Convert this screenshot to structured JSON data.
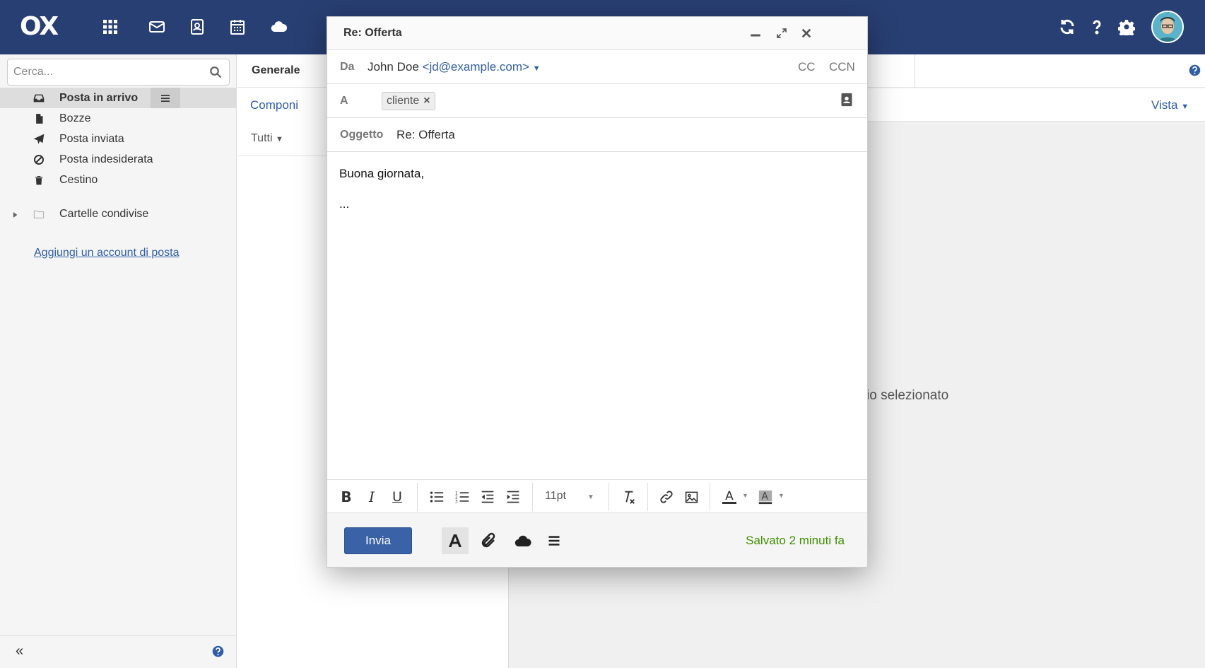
{
  "topbar": {
    "logo": "OX",
    "icons": [
      "apps-grid-icon",
      "mail-icon",
      "addressbook-icon",
      "calendar-icon",
      "cloud-icon",
      "refresh-icon",
      "help-icon",
      "settings-gear-icon",
      "avatar"
    ]
  },
  "sidebar": {
    "search_placeholder": "Cerca...",
    "folders": [
      {
        "label": "Posta in arrivo",
        "icon": "inbox-icon"
      },
      {
        "label": "Bozze",
        "icon": "document-icon"
      },
      {
        "label": "Posta inviata",
        "icon": "send-icon"
      },
      {
        "label": "Posta indesiderata",
        "icon": "blocked-icon"
      },
      {
        "label": "Cestino",
        "icon": "trash-icon"
      }
    ],
    "shared_folders": "Cartelle condivise",
    "add_account": "Aggiungi un account di posta",
    "collapse": "«"
  },
  "list": {
    "tab": "Generale",
    "compose": "Componi",
    "filter": "Tutti"
  },
  "detail": {
    "view": "Vista",
    "no_selection": "io selezionato"
  },
  "compose": {
    "title": "Re: Offerta",
    "from_label": "Da",
    "from_name": "John Doe",
    "from_addr": "<jd@example.com>",
    "cc": "CC",
    "bcc": "CCN",
    "to_label": "A",
    "to_token": "cliente",
    "subject_label": "Oggetto",
    "subject": "Re: Offerta",
    "body_line1": "Buona giornata,",
    "body_line2": "...",
    "font_size": "11pt",
    "send": "Invia",
    "saved": "Salvato 2 minuti fa"
  },
  "colors": {
    "topbar": "#283f73",
    "accent": "#2f5ea8",
    "send_button": "#3a62a7",
    "saved_text": "#3f8f00"
  }
}
